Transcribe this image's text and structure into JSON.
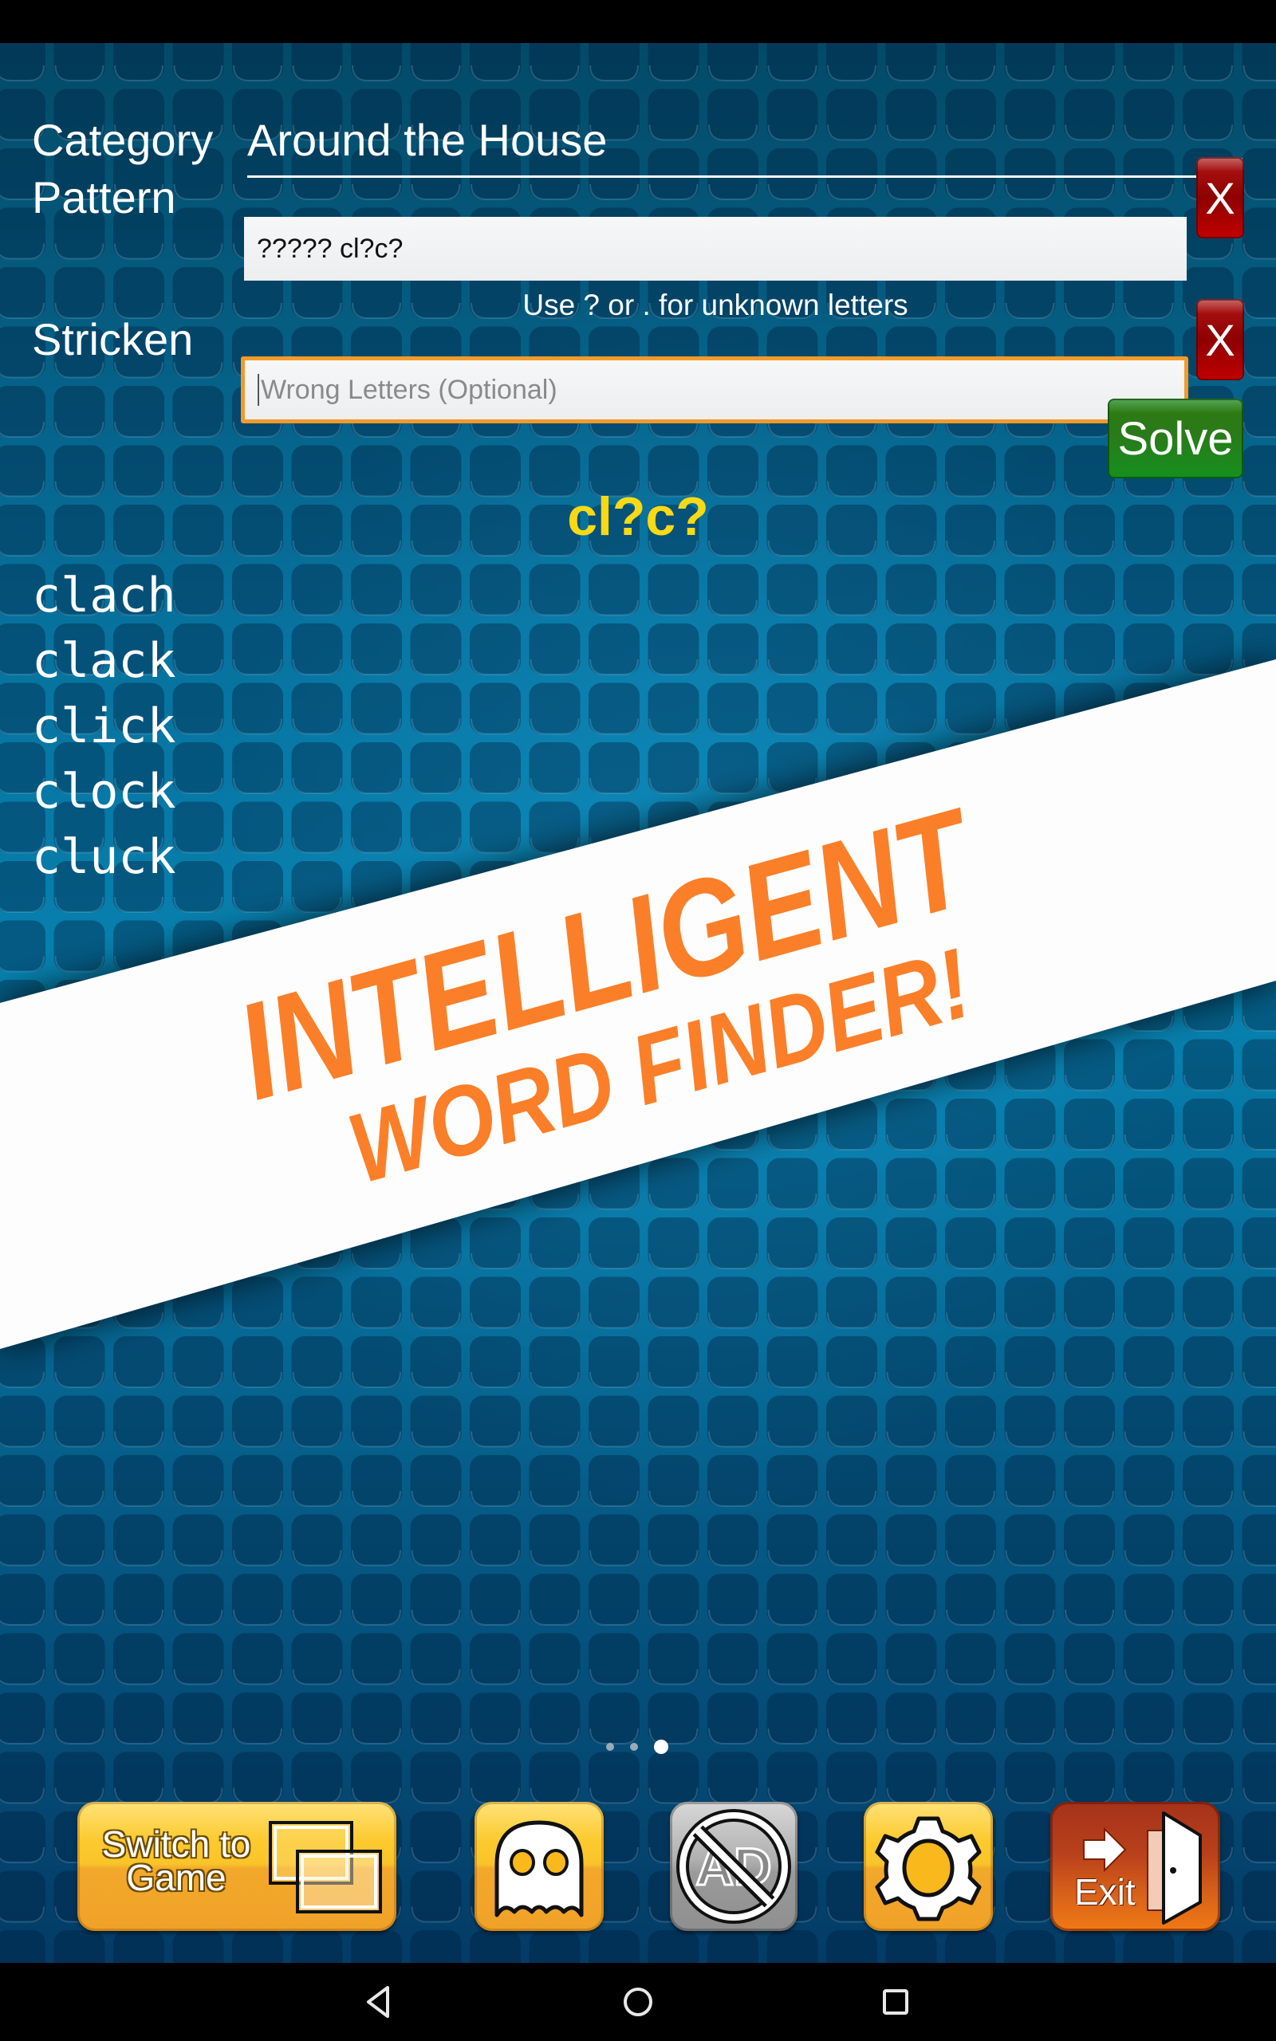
{
  "form": {
    "category_label": "Category",
    "category_value": "Around the House",
    "pattern_label": "Pattern",
    "pattern_value": "????? cl?c?",
    "pattern_hint": "Use ? or . for unknown letters",
    "stricken_label": "Stricken",
    "stricken_value": "",
    "stricken_placeholder": "Wrong Letters (Optional)",
    "clear_label": "X",
    "solve_label": "Solve"
  },
  "results": {
    "query": "cl?c?",
    "words": [
      "clach",
      "clack",
      "click",
      "clock",
      "cluck"
    ]
  },
  "banner": {
    "line1": "INTELLIGENT",
    "line2": "WORD FINDER!",
    "text_color": "#fb7f28",
    "background_color": "#fdfdfd"
  },
  "pager": {
    "total": 3,
    "active": 3
  },
  "toolbar": {
    "switch_label_line1": "Switch to",
    "switch_label_line2": "Game",
    "ghost_icon": "ghost-icon",
    "no_ads_icon": "no-ads-icon",
    "settings_icon": "gear-icon",
    "exit_label": "Exit"
  },
  "navigation": {
    "back_icon": "back-triangle-icon",
    "home_icon": "home-circle-icon",
    "recents_icon": "recents-square-icon"
  },
  "colors": {
    "accent_yellow": "#f8d914",
    "clear_red": "#a40f0f",
    "solve_green": "#2a7a1a",
    "focus_orange": "#f39a2a"
  }
}
